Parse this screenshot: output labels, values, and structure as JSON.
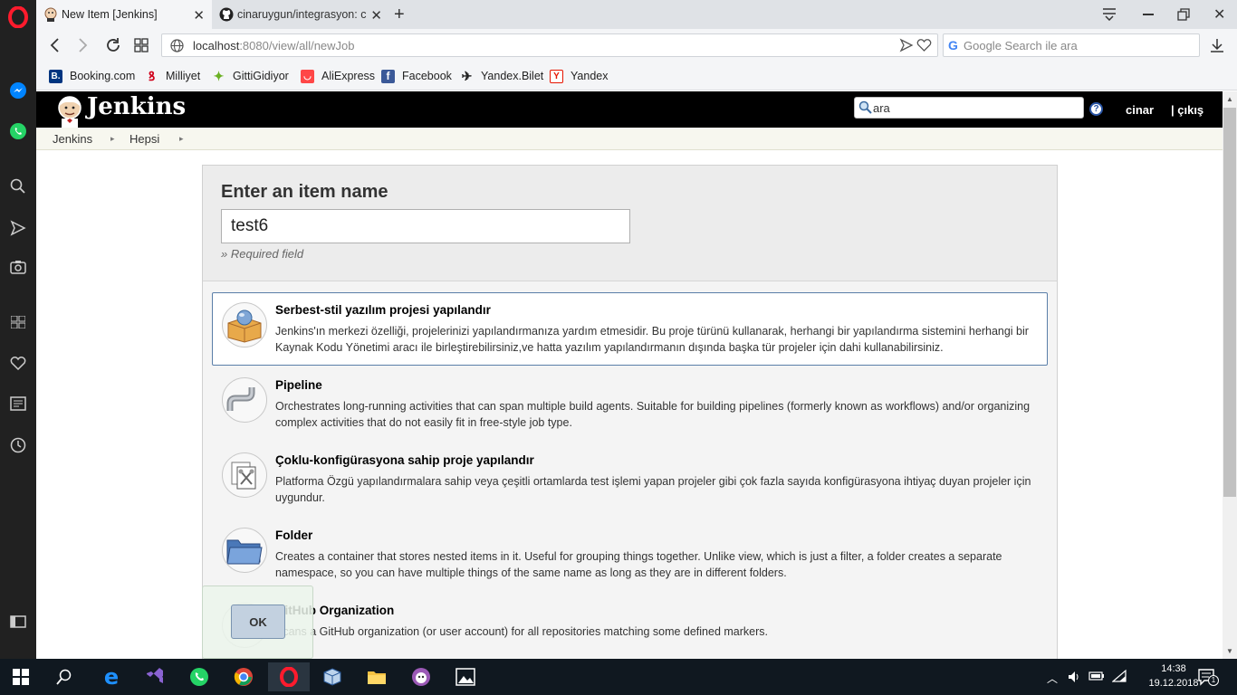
{
  "browser": {
    "tabs": [
      {
        "title": "New Item [Jenkins]",
        "active": true
      },
      {
        "title": "cinaruygun/integrasyon: c",
        "active": false
      }
    ],
    "new_tab_label": "+",
    "url": {
      "host": "localhost",
      "rest": ":8080/view/all/newJob"
    },
    "search_placeholder": "Google Search ile ara",
    "bookmarks": [
      {
        "label": "Booking.com",
        "icon": "booking-icon",
        "color": "#003580"
      },
      {
        "label": "Milliyet",
        "icon": "milliyet-icon",
        "color": "#d0021b"
      },
      {
        "label": "GittiGidiyor",
        "icon": "gittigidiyor-icon",
        "color": "#6ab023"
      },
      {
        "label": "AliExpress",
        "icon": "aliexpress-icon",
        "color": "#ff4747"
      },
      {
        "label": "Facebook",
        "icon": "facebook-icon",
        "color": "#3b5998"
      },
      {
        "label": "Yandex.Bilet",
        "icon": "plane-icon",
        "color": "#222222"
      },
      {
        "label": "Yandex",
        "icon": "yandex-icon",
        "color": "#e61400"
      }
    ]
  },
  "jenkins": {
    "logo_text": "Jenkins",
    "search_placeholder": "ara",
    "help_label": "?",
    "user": "cinar",
    "logout": "| çıkış",
    "breadcrumbs": [
      "Jenkins",
      "Hepsi"
    ],
    "new_item": {
      "heading": "Enter an item name",
      "name_value": "test6",
      "required_note": "» Required field"
    },
    "item_types": [
      {
        "title": "Serbest-stil yazılım projesi yapılandır",
        "description": "Jenkins'ın merkezi özelliği, projelerinizi yapılandırmanıza yardım etmesidir. Bu proje türünü kullanarak, herhangi bir yapılandırma sistemini herhangi bir Kaynak Kodu Yönetimi aracı ile birleştirebilirsiniz,ve hatta yazılım yapılandırmanın dışında başka tür projeler için dahi kullanabilirsiniz.",
        "icon": "freestyle-box-icon",
        "selected": true
      },
      {
        "title": "Pipeline",
        "description": "Orchestrates long-running activities that can span multiple build agents. Suitable for building pipelines (formerly known as workflows) and/or organizing complex activities that do not easily fit in free-style job type.",
        "icon": "pipe-icon",
        "selected": false
      },
      {
        "title": "Çoklu-konfigürasyona sahip proje yapılandır",
        "description": "Platforma Özgü yapılandırmalara sahip veya çeşitli ortamlarda test işlemi yapan projeler gibi çok fazla sayıda konfigürasyona ihtiyaç duyan projeler için uygundur.",
        "icon": "multi-config-icon",
        "selected": false
      },
      {
        "title": "Folder",
        "description": "Creates a container that stores nested items in it. Useful for grouping things together. Unlike view, which is just a filter, a folder creates a separate namespace, so you can have multiple things of the same name as long as they are in different folders.",
        "icon": "folder-icon",
        "selected": false
      },
      {
        "title": "GitHub Organization",
        "description": "Scans a GitHub organization (or user account) for all repositories matching some defined markers.",
        "icon": "github-org-icon",
        "selected": false
      }
    ],
    "ok_button": "OK"
  },
  "taskbar": {
    "time": "14:38",
    "date": "19.12.2018",
    "notification_count": "1",
    "apps": [
      "start-icon",
      "search-icon",
      "edge-icon",
      "visual-studio-icon",
      "whatsapp-icon",
      "chrome-icon",
      "opera-icon",
      "virtualbox-icon",
      "file-explorer-icon",
      "app-icon",
      "photos-icon"
    ]
  },
  "colors": {
    "jenkins_header": "#000000",
    "selected_border": "#5a7ea8",
    "opera_red": "#ff1b2d"
  }
}
